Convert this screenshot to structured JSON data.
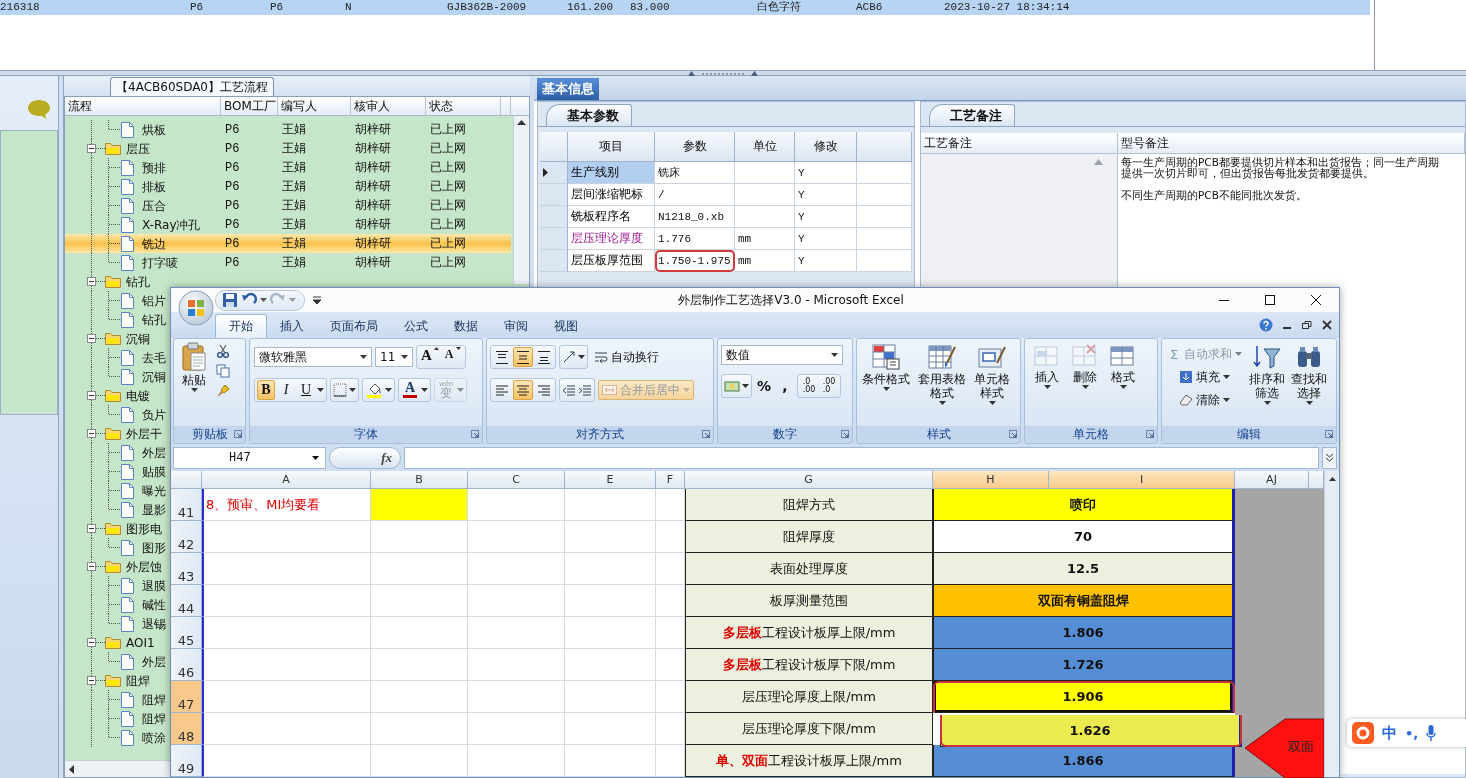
{
  "top_table": {
    "row": {
      "selected": true,
      "cells": [
        "216318",
        "P6",
        "P6",
        "N",
        "GJB362B-2009",
        "161.200",
        "83.000",
        "白色字符",
        "ACB6",
        "2023-10-27 18:34:14"
      ]
    }
  },
  "flow_panel": {
    "title": "【4ACB60SDA0】工艺流程",
    "columns": [
      "流程",
      "BOM工厂",
      "编写人",
      "核审人",
      "状态"
    ],
    "tree": [
      {
        "kind": "continuation",
        "children": [
          {
            "label": "烘板",
            "bom": "P6",
            "writer": "王娟",
            "reviewer": "胡梓研",
            "status": "已上网",
            "selected": false
          }
        ]
      },
      {
        "kind": "folder",
        "label": "层压",
        "expanded": true,
        "bom": "P6",
        "writer": "王娟",
        "reviewer": "胡梓研",
        "status": "已上网",
        "selected": false,
        "children": [
          {
            "label": "预排",
            "bom": "P6",
            "writer": "王娟",
            "reviewer": "胡梓研",
            "status": "已上网",
            "selected": false
          },
          {
            "label": "排板",
            "bom": "P6",
            "writer": "王娟",
            "reviewer": "胡梓研",
            "status": "已上网",
            "selected": false
          },
          {
            "label": "压合",
            "bom": "P6",
            "writer": "王娟",
            "reviewer": "胡梓研",
            "status": "已上网",
            "selected": false
          },
          {
            "label": "X-Ray冲孔",
            "bom": "P6",
            "writer": "王娟",
            "reviewer": "胡梓研",
            "status": "已上网",
            "selected": false
          },
          {
            "label": "铣边",
            "bom": "P6",
            "writer": "王娟",
            "reviewer": "胡梓研",
            "status": "已上网",
            "selected": true
          },
          {
            "label": "打字唛",
            "bom": "P6",
            "writer": "王娟",
            "reviewer": "胡梓研",
            "status": "已上网",
            "selected": false
          }
        ]
      },
      {
        "kind": "folder",
        "label": "钻孔",
        "expanded": true,
        "selected": false,
        "children": [
          {
            "label": "铝片",
            "selected": false
          },
          {
            "label": "钻孔",
            "selected": false
          }
        ]
      },
      {
        "kind": "folder",
        "label": "沉铜",
        "expanded": true,
        "selected": false,
        "children": [
          {
            "label": "去毛",
            "selected": false
          },
          {
            "label": "沉铜",
            "selected": false
          }
        ]
      },
      {
        "kind": "folder",
        "label": "电镀",
        "expanded": true,
        "selected": false,
        "children": [
          {
            "label": "负片",
            "selected": false
          }
        ]
      },
      {
        "kind": "folder",
        "label": "外层干",
        "expanded": true,
        "selected": false,
        "children": [
          {
            "label": "外层",
            "selected": false
          },
          {
            "label": "贴膜",
            "selected": false
          },
          {
            "label": "曝光",
            "selected": false
          },
          {
            "label": "显影",
            "selected": false
          }
        ]
      },
      {
        "kind": "folder",
        "label": "图形电",
        "expanded": true,
        "selected": false,
        "children": [
          {
            "label": "图形",
            "selected": false
          }
        ]
      },
      {
        "kind": "folder",
        "label": "外层蚀",
        "expanded": true,
        "selected": false,
        "children": [
          {
            "label": "退膜",
            "selected": false
          },
          {
            "label": "碱性",
            "selected": false
          },
          {
            "label": "退锡",
            "selected": false
          }
        ]
      },
      {
        "kind": "folder",
        "label": "AOI1",
        "expanded": true,
        "selected": false,
        "children": [
          {
            "label": "外层",
            "selected": false
          }
        ]
      },
      {
        "kind": "folder",
        "label": "阻焊",
        "expanded": true,
        "selected": false,
        "children": [
          {
            "label": "阻焊",
            "selected": false
          },
          {
            "label": "阻焊",
            "selected": false
          },
          {
            "label": "喷涂",
            "selected": false
          }
        ]
      }
    ]
  },
  "info": {
    "tab": "基本信息",
    "params": {
      "tab": "基本参数",
      "columns": [
        "项目",
        "参数",
        "单位",
        "修改"
      ],
      "rows": [
        {
          "item": "生产线别",
          "value": "铣床",
          "modify": "Y",
          "current": true,
          "kind": "plain",
          "outlined": false
        },
        {
          "item": "层间涨缩靶标",
          "value": "/",
          "modify": "Y",
          "current": false,
          "kind": "plain",
          "outlined": false
        },
        {
          "item": "铣板程序名",
          "value": "N1218_0.xb",
          "modify": "Y",
          "current": false,
          "kind": "plain",
          "outlined": false
        },
        {
          "item": "层压理论厚度",
          "value": "1.776",
          "unit": "mm",
          "modify": "Y",
          "current": false,
          "kind": "emphasis",
          "outlined": false
        },
        {
          "item": "层压板厚范围",
          "value": "1.750-1.975",
          "unit": "mm",
          "modify": "Y",
          "current": false,
          "kind": "plain",
          "outlined": true
        }
      ]
    },
    "notes": {
      "tab": "工艺备注",
      "columns": [
        "工艺备注",
        "型号备注"
      ],
      "model_notes": [
        {
          "lines": [
            "每一生产周期的PCB都要提供切片样本和出货报告；同一生产周期",
            "提供一次切片即可，但出货报告每批发货都要提供。"
          ]
        },
        {
          "lines": [
            "不同生产周期的PCB不能同批次发货。"
          ]
        }
      ]
    }
  },
  "excel": {
    "title": "外层制作工艺选择V3.0 - Microsoft Excel",
    "tabs": [
      {
        "label": "开始",
        "selected": true
      },
      {
        "label": "插入",
        "selected": false
      },
      {
        "label": "页面布局",
        "selected": false
      },
      {
        "label": "公式",
        "selected": false
      },
      {
        "label": "数据",
        "selected": false
      },
      {
        "label": "审阅",
        "selected": false
      },
      {
        "label": "视图",
        "selected": false
      }
    ],
    "ribbon": {
      "clipboard": {
        "label": "剪贴板",
        "paste": "粘贴"
      },
      "font": {
        "label": "字体",
        "font_name": "微软雅黑",
        "font_size": "11",
        "grow": "A",
        "shrink": "A",
        "styles": [
          {
            "label": "B",
            "selected": true
          },
          {
            "label": "I",
            "selected": false
          },
          {
            "label": "U",
            "selected": false
          }
        ],
        "fill": {
          "color": "#ffff00"
        },
        "font_color": {
          "label": "A",
          "color": "#c00000"
        },
        "phonetic": {
          "label": "变",
          "ruby": "wén",
          "disabled": true
        }
      },
      "alignment": {
        "label": "对齐方式",
        "vertical": [
          {
            "selected": false
          },
          {
            "selected": true
          },
          {
            "selected": false
          }
        ],
        "horizontal": [
          {
            "selected": false
          },
          {
            "selected": true
          },
          {
            "selected": false
          }
        ],
        "wrap_text": "自动换行",
        "merge": {
          "label": "合并后居中",
          "disabled": true
        }
      },
      "number": {
        "label": "数字",
        "format": "数值",
        "symbols": [
          "%",
          ","
        ],
        "decimals": [
          {
            "top": ".0",
            "bottom": ".00"
          },
          {
            "top": ".00",
            "bottom": ".0"
          }
        ]
      },
      "styles": {
        "label": "样式",
        "buttons": [
          "条件格式",
          "套用表格格式",
          "单元格样式"
        ]
      },
      "cells": {
        "label": "单元格",
        "buttons": [
          {
            "label": "插入",
            "disabled": true
          },
          {
            "label": "删除",
            "disabled": true
          },
          {
            "label": "格式",
            "disabled": false
          }
        ]
      },
      "editing": {
        "label": "编辑",
        "small": [
          {
            "icon": "Σ",
            "label": "自动求和",
            "disabled": true
          },
          {
            "label": "填充",
            "disabled": false
          },
          {
            "label": "清除",
            "disabled": false
          }
        ],
        "big": [
          "排序和筛选",
          "查找和选择"
        ]
      }
    },
    "name_box": "H47",
    "fx": "fx",
    "columns": [
      {
        "label": "A",
        "selected": false
      },
      {
        "label": "B",
        "selected": false
      },
      {
        "label": "C",
        "selected": false
      },
      {
        "label": "E",
        "selected": false
      },
      {
        "label": "F",
        "selected": false
      },
      {
        "label": "G",
        "selected": false
      },
      {
        "label": "H",
        "selected": true
      },
      {
        "label": "I",
        "selected": true
      },
      {
        "label": "AJ",
        "selected": false
      }
    ],
    "rows": [
      {
        "number": "41",
        "selected": false,
        "a": "8、预审、MI均要看",
        "b": {
          "color": "#ffff00"
        },
        "label": "阻焊方式",
        "value": "喷印",
        "color": "#ffff00",
        "active": false,
        "outlined": false
      },
      {
        "number": "42",
        "selected": false,
        "label": "阻焊厚度",
        "value": "70",
        "color": "#ffffff",
        "active": false,
        "outlined": false
      },
      {
        "number": "43",
        "selected": false,
        "label": "表面处理厚度",
        "value": "12.5",
        "color": "#ebf1de",
        "active": false,
        "outlined": false
      },
      {
        "number": "44",
        "selected": false,
        "label": "板厚测量范围",
        "value": "双面有铜盖阻焊",
        "color": "#ffc000",
        "active": false,
        "outlined": false
      },
      {
        "number": "45",
        "selected": false,
        "label": "**多层板**工程设计板厚上限/mm",
        "value": "1.806",
        "color": "#558ed5",
        "active": false,
        "outlined": false
      },
      {
        "number": "46",
        "selected": false,
        "label": "**多层板**工程设计板厚下限/mm",
        "value": "1.726",
        "color": "#558ed5",
        "active": false,
        "outlined": false
      },
      {
        "number": "47",
        "selected": true,
        "label": "层压理论厚度上限/mm",
        "value": "1.906",
        "color": "#ffff00",
        "active": true,
        "outlined": true
      },
      {
        "number": "48",
        "selected": true,
        "label": "层压理论厚度下限/mm",
        "value": "1.626",
        "color": "#ebeb50",
        "active": false,
        "outlined": true
      },
      {
        "number": "49",
        "selected": false,
        "label": "**单、双面**工程设计板厚上限/mm",
        "value": "1.866",
        "color": "#558ed5",
        "active": false,
        "outlined": false
      }
    ]
  },
  "callout": {
    "text": "双面"
  },
  "ime": {
    "mode": "中",
    "punct": "•,"
  }
}
